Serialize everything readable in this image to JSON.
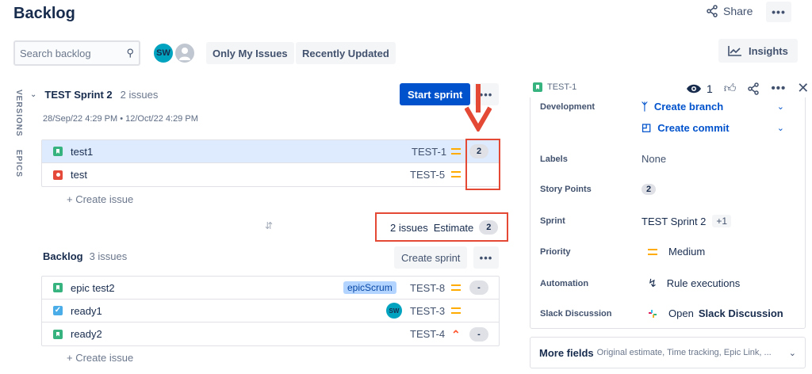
{
  "header": {
    "title": "Backlog",
    "share_label": "Share",
    "more_label": "•••"
  },
  "toolbar": {
    "search_placeholder": "Search backlog",
    "avatar_initials": "SW",
    "filter_only_my_issues": "Only My Issues",
    "filter_recently_updated": "Recently Updated",
    "insights_label": "Insights"
  },
  "side_tabs": {
    "versions": "VERSIONS",
    "epics": "EPICS"
  },
  "sprint": {
    "name": "TEST Sprint 2",
    "issue_count": "2 issues",
    "dates": "28/Sep/22 4:29 PM  •  12/Oct/22 4:29 PM",
    "start_label": "Start sprint",
    "more_label": "•••",
    "issues": [
      {
        "summary": "test1",
        "key": "TEST-1",
        "type": "story",
        "priority": "medium",
        "estimate": "2"
      },
      {
        "summary": "test",
        "key": "TEST-5",
        "type": "bug",
        "priority": "medium",
        "estimate": ""
      }
    ],
    "create_issue": "+ Create issue",
    "footer_issues": "2 issues",
    "footer_estimate_label": "Estimate",
    "footer_estimate_value": "2"
  },
  "backlog": {
    "name": "Backlog",
    "issue_count": "3 issues",
    "create_sprint_label": "Create sprint",
    "more_label": "•••",
    "issues": [
      {
        "summary": "epic test2",
        "key": "TEST-8",
        "type": "story",
        "priority": "medium",
        "estimate": "-",
        "epic": "epicScrum"
      },
      {
        "summary": "ready1",
        "key": "TEST-3",
        "type": "task",
        "priority": "medium",
        "estimate": "",
        "assignee": "SW"
      },
      {
        "summary": "ready2",
        "key": "TEST-4",
        "type": "story",
        "priority": "high",
        "estimate": "-"
      }
    ],
    "create_issue": "+ Create issue"
  },
  "detail": {
    "key": "TEST-1",
    "watchers": "1",
    "fields": {
      "development_label": "Development",
      "create_branch": "Create branch",
      "create_commit": "Create commit",
      "labels_label": "Labels",
      "labels_value": "None",
      "story_points_label": "Story Points",
      "story_points_value": "2",
      "sprint_label": "Sprint",
      "sprint_value": "TEST Sprint 2",
      "sprint_extra": "+1",
      "priority_label": "Priority",
      "priority_value": "Medium",
      "automation_label": "Automation",
      "automation_value": "Rule executions",
      "slack_label": "Slack Discussion",
      "slack_prefix": "Open",
      "slack_value": "Slack Discussion"
    },
    "more_fields_title": "More fields",
    "more_fields_sub": "Original estimate, Time tracking, Epic Link, ..."
  },
  "colors": {
    "primary": "#0052cc",
    "annotation_red": "#e34935",
    "selected_row": "#deebff"
  }
}
